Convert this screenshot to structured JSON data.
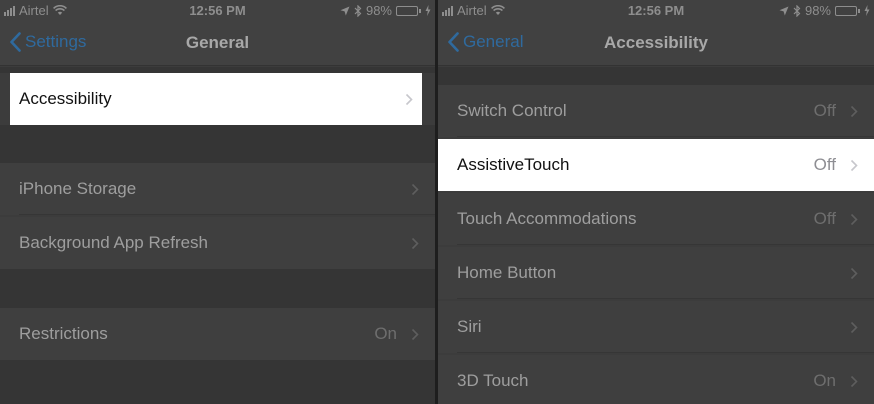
{
  "left": {
    "status": {
      "carrier": "Airtel",
      "time": "12:56 PM",
      "battery": "98%",
      "battery_level": 0.98
    },
    "nav": {
      "back_label": "Settings",
      "title": "General"
    },
    "rows": [
      {
        "label": "Accessibility",
        "value": ""
      },
      {
        "label": "iPhone Storage",
        "value": ""
      },
      {
        "label": "Background App Refresh",
        "value": ""
      },
      {
        "label": "Restrictions",
        "value": "On"
      }
    ]
  },
  "right": {
    "status": {
      "carrier": "Airtel",
      "time": "12:56 PM",
      "battery": "98%",
      "battery_level": 0.98
    },
    "nav": {
      "back_label": "General",
      "title": "Accessibility"
    },
    "rows": [
      {
        "label": "Switch Control",
        "value": "Off"
      },
      {
        "label": "AssistiveTouch",
        "value": "Off"
      },
      {
        "label": "Touch Accommodations",
        "value": "Off"
      },
      {
        "label": "Home Button",
        "value": ""
      },
      {
        "label": "Siri",
        "value": ""
      },
      {
        "label": "3D Touch",
        "value": "On"
      }
    ]
  },
  "colors": {
    "accent": "#2f6a9e",
    "highlight": "#ffffff",
    "dim_background": "#3f3f3f",
    "battery_fill": "#4a8a3a"
  },
  "icons": [
    "signal-icon",
    "wifi-icon",
    "location-icon",
    "bluetooth-icon",
    "battery-icon",
    "charging-icon",
    "back-chevron-icon",
    "chevron-right-icon"
  ]
}
